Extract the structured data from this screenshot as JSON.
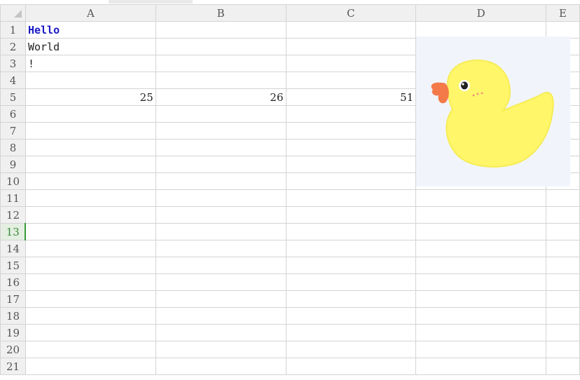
{
  "columns": [
    "A",
    "B",
    "C",
    "D",
    "E"
  ],
  "rows": [
    "1",
    "2",
    "3",
    "4",
    "5",
    "6",
    "7",
    "8",
    "9",
    "10",
    "11",
    "12",
    "13",
    "14",
    "15",
    "16",
    "17",
    "18",
    "19",
    "20",
    "21"
  ],
  "active_row": "13",
  "cells": {
    "A1": "Hello",
    "A2": "World",
    "A3": "!",
    "A5": "25",
    "B5": "26",
    "C5": "51"
  },
  "image": {
    "icon": "rubber-duck-icon",
    "colors": {
      "body": "#fff66a",
      "beak": "#f47a4a",
      "background": "#f1f5fb"
    }
  }
}
